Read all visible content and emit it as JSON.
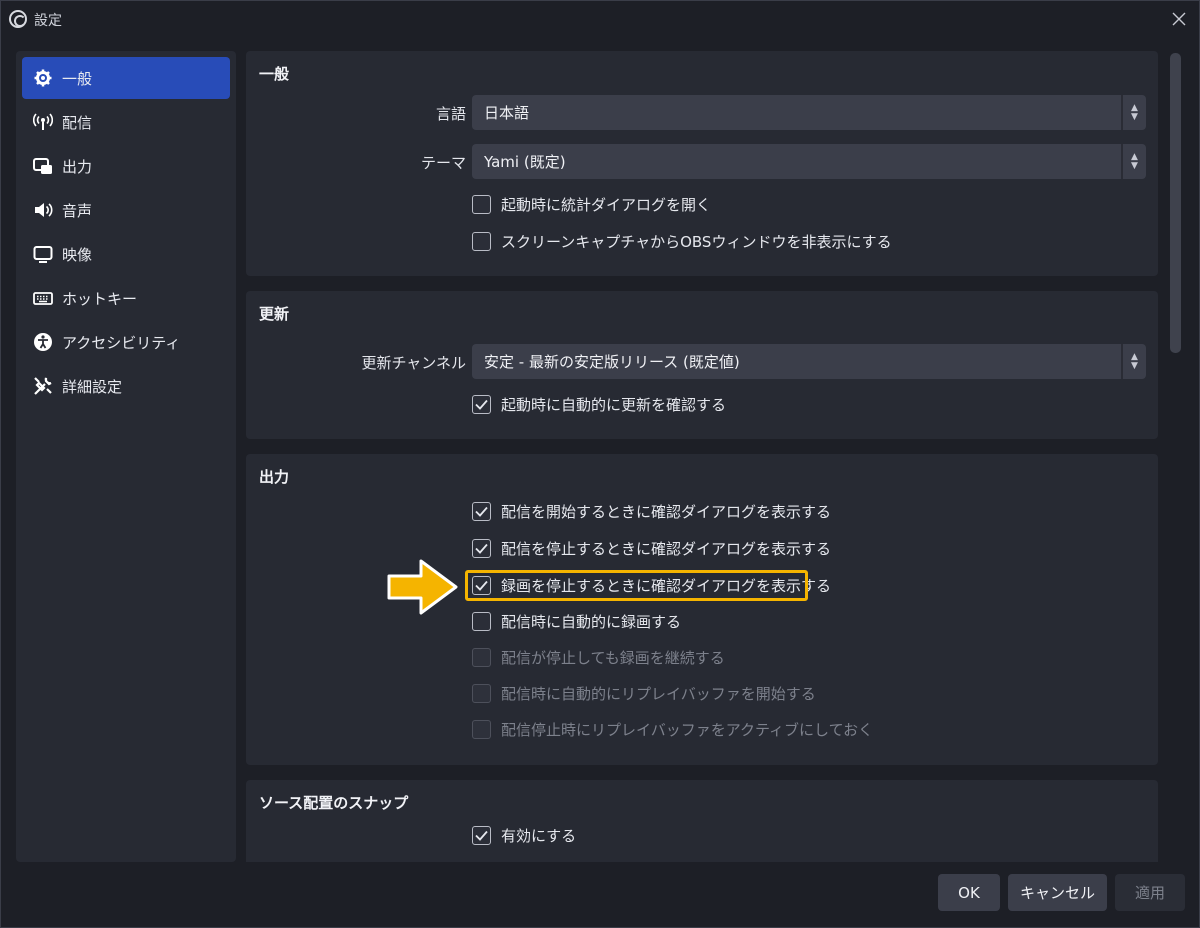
{
  "window": {
    "title": "設定"
  },
  "sidebar": {
    "items": [
      {
        "label": "一般",
        "icon": "gear-icon",
        "active": true
      },
      {
        "label": "配信",
        "icon": "broadcast-antenna-icon"
      },
      {
        "label": "出力",
        "icon": "output-icon"
      },
      {
        "label": "音声",
        "icon": "speaker-icon"
      },
      {
        "label": "映像",
        "icon": "monitor-icon"
      },
      {
        "label": "ホットキー",
        "icon": "keyboard-icon"
      },
      {
        "label": "アクセシビリティ",
        "icon": "accessibility-icon"
      },
      {
        "label": "詳細設定",
        "icon": "tools-icon"
      }
    ]
  },
  "general": {
    "title": "一般",
    "language_label": "言語",
    "language_value": "日本語",
    "theme_label": "テーマ",
    "theme_value": "Yami (既定)",
    "checks": [
      {
        "label": "起動時に統計ダイアログを開く",
        "checked": false
      },
      {
        "label": "スクリーンキャプチャからOBSウィンドウを非表示にする",
        "checked": false
      }
    ]
  },
  "update": {
    "title": "更新",
    "channel_label": "更新チャンネル",
    "channel_value": "安定 - 最新の安定版リリース (既定値)",
    "checks": [
      {
        "label": "起動時に自動的に更新を確認する",
        "checked": true
      }
    ]
  },
  "output": {
    "title": "出力",
    "checks": [
      {
        "label": "配信を開始するときに確認ダイアログを表示する",
        "checked": true,
        "disabled": false
      },
      {
        "label": "配信を停止するときに確認ダイアログを表示する",
        "checked": true,
        "disabled": false
      },
      {
        "label": "録画を停止するときに確認ダイアログを表示する",
        "checked": true,
        "disabled": false
      },
      {
        "label": "配信時に自動的に録画する",
        "checked": false,
        "disabled": false
      },
      {
        "label": "配信が停止しても録画を継続する",
        "checked": false,
        "disabled": true
      },
      {
        "label": "配信時に自動的にリプレイバッファを開始する",
        "checked": false,
        "disabled": true
      },
      {
        "label": "配信停止時にリプレイバッファをアクティブにしておく",
        "checked": false,
        "disabled": true
      }
    ]
  },
  "snap": {
    "title": "ソース配置のスナップ",
    "checks": [
      {
        "label": "有効にする",
        "checked": true
      }
    ]
  },
  "footer": {
    "ok": "OK",
    "cancel": "キャンセル",
    "apply": "適用"
  },
  "colors": {
    "accent": "#284cb8",
    "highlight": "#f5b400"
  }
}
